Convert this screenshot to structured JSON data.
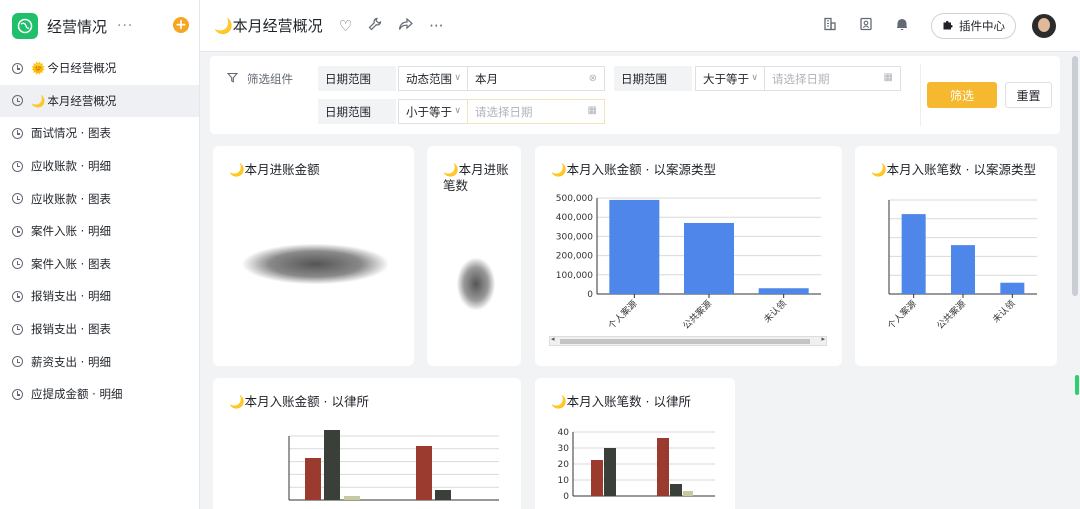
{
  "sidebar": {
    "app_title": "经营情况",
    "more": "···",
    "add": "+",
    "items": [
      {
        "emoji": "🌞",
        "label": "今日经营概况"
      },
      {
        "emoji": "🌙",
        "label": "本月经营概况"
      },
      {
        "emoji": "",
        "label": "面试情况 · 图表"
      },
      {
        "emoji": "",
        "label": "应收账款 · 明细"
      },
      {
        "emoji": "",
        "label": "应收账款 · 图表"
      },
      {
        "emoji": "",
        "label": "案件入账 · 明细"
      },
      {
        "emoji": "",
        "label": "案件入账 · 图表"
      },
      {
        "emoji": "",
        "label": "报销支出 · 明细"
      },
      {
        "emoji": "",
        "label": "报销支出 · 图表"
      },
      {
        "emoji": "",
        "label": "薪资支出 · 明细"
      },
      {
        "emoji": "",
        "label": "应提成金额 · 明细"
      }
    ]
  },
  "topbar": {
    "title": "🌙本月经营概况",
    "more": "···",
    "plugin_label": "插件中心"
  },
  "filter": {
    "label": "筛选组件",
    "row1": {
      "field1": "日期范围",
      "mode1": "动态范围",
      "value1": "本月",
      "field2": "日期范围",
      "mode2": "大于等于",
      "placeholder2": "请选择日期"
    },
    "row2": {
      "field": "日期范围",
      "mode": "小于等于",
      "placeholder": "请选择日期"
    },
    "filter_button": "筛选",
    "reset_button": "重置"
  },
  "cards": {
    "card1_title": "🌙本月进账金额",
    "card2_title": "🌙本月进账笔数",
    "card3_title": "🌙本月入账金额 · 以案源类型",
    "card4_title": "🌙本月入账笔数 · 以案源类型",
    "card5_title": "🌙本月入账金额 · 以律所",
    "card6_title": "🌙本月入账笔数 · 以律所"
  },
  "colors": {
    "blue_bar": "#4f86ea",
    "red_bar": "#9b3a2f",
    "dark_bar": "#3a3f3a",
    "accent": "#f5b82e"
  },
  "chart_data": [
    {
      "type": "bar",
      "title": "🌙本月入账金额 · 以案源类型",
      "categories": [
        "个人案源",
        "公共案源",
        "未认领"
      ],
      "series": [
        {
          "values": [
            490000,
            370000,
            30000
          ]
        }
      ],
      "yticks": [
        "500,000",
        "400,000",
        "300,000",
        "200,000",
        "100,000",
        "0"
      ],
      "ylim": [
        0,
        500000
      ]
    },
    {
      "type": "bar",
      "title": "🌙本月入账笔数 · 以案源类型",
      "categories": [
        "个人案源",
        "公共案源",
        "未认领"
      ],
      "series": [
        {
          "values": [
            85,
            52,
            12
          ]
        }
      ],
      "ylim": [
        0,
        100
      ]
    },
    {
      "type": "bar",
      "title": "🌙本月入账笔数 · 以律所",
      "yticks": [
        "40",
        "30",
        "20",
        "10",
        "0"
      ],
      "ylim": [
        0,
        40
      ]
    }
  ]
}
